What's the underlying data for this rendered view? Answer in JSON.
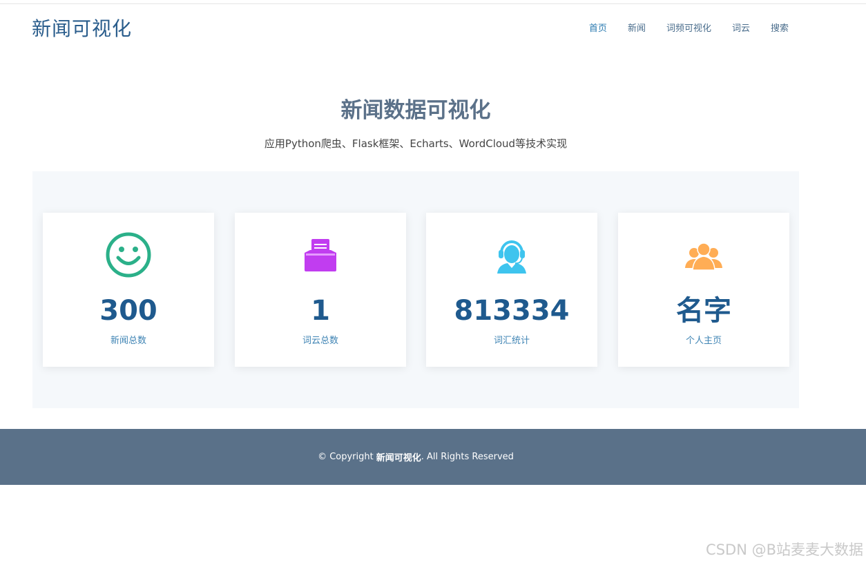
{
  "header": {
    "brand": "新闻可视化",
    "nav": [
      "首页",
      "新闻",
      "词频可视化",
      "词云",
      "搜索"
    ]
  },
  "hero": {
    "title": "新闻数据可视化",
    "subtitle": "应用Python爬虫、Flask框架、Echarts、WordCloud等技术实现"
  },
  "stats": [
    {
      "value": "300",
      "label": "新闻总数",
      "icon": "smiley-icon",
      "color": "#2bb089"
    },
    {
      "value": "1",
      "label": "词云总数",
      "icon": "inbox-document-icon",
      "color": "#c13df0"
    },
    {
      "value": "813334",
      "label": "词汇统计",
      "icon": "support-agent-icon",
      "color": "#3ec4ee"
    },
    {
      "value": "名字",
      "label": "个人主页",
      "icon": "group-users-icon",
      "color": "#ffad55"
    }
  ],
  "footer": {
    "prefix": "© Copyright",
    "brand": "新闻可视化",
    "suffix": ". All Rights Reserved"
  },
  "watermark": "CSDN @B站麦麦大数据"
}
